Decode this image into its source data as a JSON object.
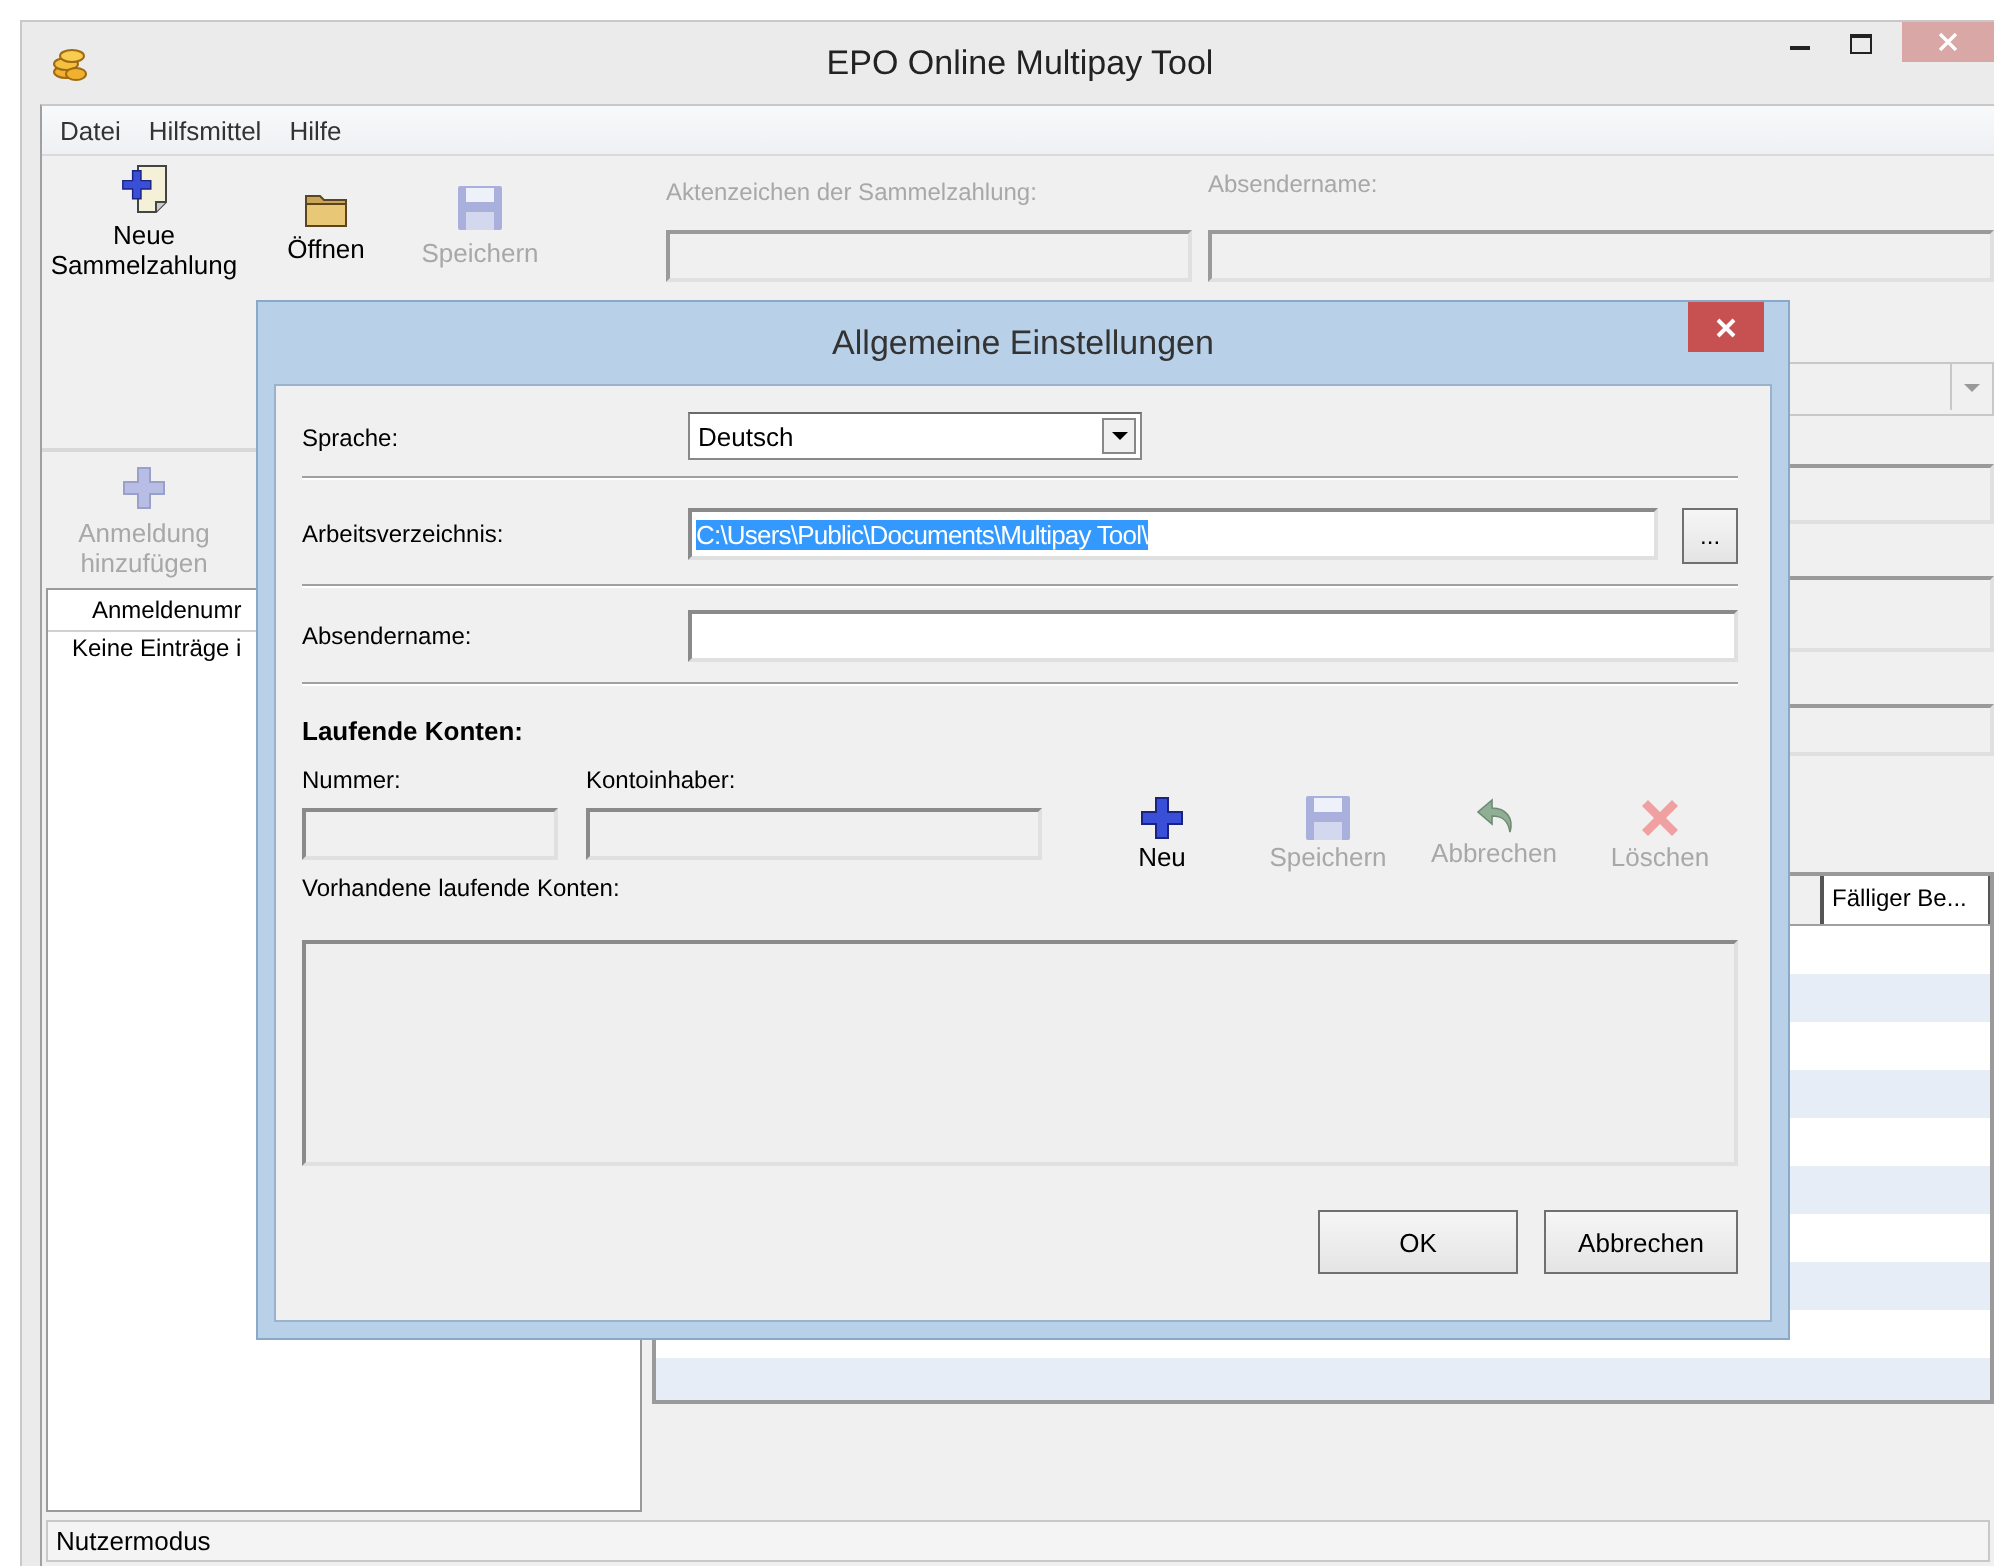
{
  "window": {
    "title": "EPO Online Multipay Tool"
  },
  "menu": [
    {
      "label": "Datei"
    },
    {
      "label": "Hilfsmittel"
    },
    {
      "label": "Hilfe"
    }
  ],
  "toolbar": [
    {
      "label": "Neue Sammelzahlung",
      "kind": "new",
      "disabled": false
    },
    {
      "label": "Öffnen",
      "kind": "open",
      "disabled": false
    },
    {
      "label": "Speichern",
      "kind": "save",
      "disabled": true
    }
  ],
  "form": {
    "fields": [
      {
        "label": "Aktenzeichen der Sammelzahlung:",
        "disabled": true
      },
      {
        "label": "Absendername:",
        "disabled": true
      }
    ]
  },
  "applications": {
    "add_button": {
      "label": "Anmeldung hinzufügen",
      "disabled": true
    },
    "columns": [
      "Anmeldenumr"
    ],
    "empty_text": "Keine Einträge i"
  },
  "payments_table": {
    "columns": [
      "Fälliger Be..."
    ]
  },
  "status_bar": "Nutzermodus",
  "dialog": {
    "title": "Allgemeine Einstellungen",
    "language": {
      "label": "Sprache:",
      "value": "Deutsch"
    },
    "work_dir": {
      "label": "Arbeitsverzeichnis:",
      "value": "C:\\Users\\Public\\Documents\\Multipay Tool\\",
      "text_selected": true,
      "browse": "..."
    },
    "sender": {
      "label": "Absendername:"
    },
    "accounts": {
      "heading": "Laufende Konten:",
      "fields": [
        {
          "label": "Nummer:",
          "disabled": true
        },
        {
          "label": "Kontoinhaber:",
          "disabled": true
        }
      ],
      "actions": [
        {
          "label": "Neu",
          "kind": "add",
          "disabled": false
        },
        {
          "label": "Speichern",
          "kind": "save",
          "disabled": true
        },
        {
          "label": "Abbrechen",
          "kind": "undo",
          "disabled": true
        },
        {
          "label": "Löschen",
          "kind": "delete",
          "disabled": true
        }
      ],
      "list_label": "Vorhandene laufende Konten:"
    },
    "buttons": [
      {
        "label": "OK"
      },
      {
        "label": "Abbrechen"
      }
    ]
  }
}
